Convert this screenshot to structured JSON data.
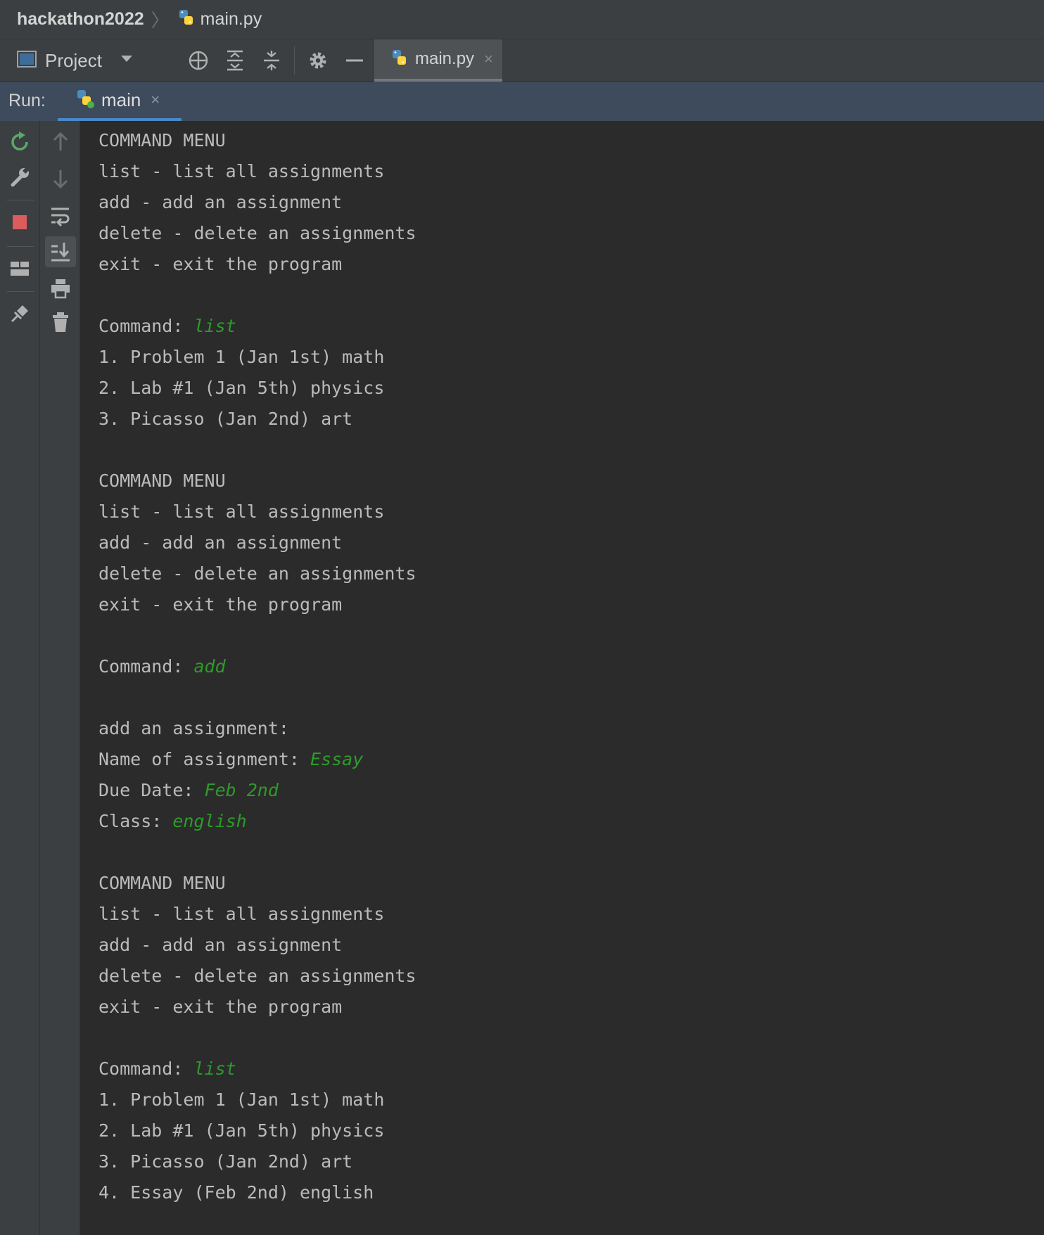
{
  "breadcrumb": {
    "project": "hackathon2022",
    "file": "main.py"
  },
  "toolbar": {
    "project_label": "Project",
    "icons": [
      "project-panel-icon",
      "dropdown-icon",
      "locate-icon",
      "expand-all-icon",
      "collapse-all-icon",
      "gear-icon",
      "minimize-icon"
    ],
    "file_tab": {
      "label": "main.py",
      "close": "×"
    }
  },
  "run": {
    "label": "Run:",
    "tab": {
      "label": "main",
      "close": "×"
    }
  },
  "gutter_icons": {
    "left": [
      "rerun-icon",
      "wrench-icon",
      "stop-icon",
      "layout-icon",
      "pin-icon"
    ],
    "right": [
      "arrow-up-icon",
      "arrow-down-icon",
      "soft-wrap-icon",
      "scroll-to-end-icon",
      "print-icon",
      "trash-icon"
    ]
  },
  "colors": {
    "input": "#2d9b2a",
    "output": "#bbbbbb",
    "run_bar": "#3d4b5c",
    "tab_underline": "#4a88c7"
  },
  "console": {
    "lines": [
      {
        "text": "COMMAND MENU",
        "input": ""
      },
      {
        "text": "list - list all assignments",
        "input": ""
      },
      {
        "text": "add - add an assignment",
        "input": ""
      },
      {
        "text": "delete - delete an assignments",
        "input": ""
      },
      {
        "text": "exit - exit the program",
        "input": ""
      },
      {
        "text": "",
        "input": ""
      },
      {
        "text": "Command: ",
        "input": "list"
      },
      {
        "text": "1. Problem 1 (Jan 1st) math",
        "input": ""
      },
      {
        "text": "2. Lab #1 (Jan 5th) physics",
        "input": ""
      },
      {
        "text": "3. Picasso (Jan 2nd) art",
        "input": ""
      },
      {
        "text": "",
        "input": ""
      },
      {
        "text": "COMMAND MENU",
        "input": ""
      },
      {
        "text": "list - list all assignments",
        "input": ""
      },
      {
        "text": "add - add an assignment",
        "input": ""
      },
      {
        "text": "delete - delete an assignments",
        "input": ""
      },
      {
        "text": "exit - exit the program",
        "input": ""
      },
      {
        "text": "",
        "input": ""
      },
      {
        "text": "Command: ",
        "input": "add"
      },
      {
        "text": "",
        "input": ""
      },
      {
        "text": "add an assignment:",
        "input": ""
      },
      {
        "text": "Name of assignment: ",
        "input": "Essay"
      },
      {
        "text": "Due Date: ",
        "input": "Feb 2nd"
      },
      {
        "text": "Class: ",
        "input": "english"
      },
      {
        "text": "",
        "input": ""
      },
      {
        "text": "COMMAND MENU",
        "input": ""
      },
      {
        "text": "list - list all assignments",
        "input": ""
      },
      {
        "text": "add - add an assignment",
        "input": ""
      },
      {
        "text": "delete - delete an assignments",
        "input": ""
      },
      {
        "text": "exit - exit the program",
        "input": ""
      },
      {
        "text": "",
        "input": ""
      },
      {
        "text": "Command: ",
        "input": "list"
      },
      {
        "text": "1. Problem 1 (Jan 1st) math",
        "input": ""
      },
      {
        "text": "2. Lab #1 (Jan 5th) physics",
        "input": ""
      },
      {
        "text": "3. Picasso (Jan 2nd) art",
        "input": ""
      },
      {
        "text": "4. Essay (Feb 2nd) english",
        "input": ""
      }
    ]
  }
}
